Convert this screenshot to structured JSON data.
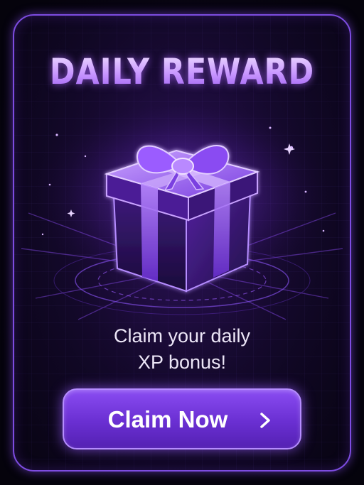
{
  "title": "DAILY REWARD",
  "subtitle": {
    "line1": "Claim your daily",
    "line2": "XP bonus!"
  },
  "claim_button": {
    "label": "Claim Now",
    "icon": "chevron-right-icon"
  },
  "colors": {
    "accent": "#8a4cf2",
    "border": "#7d4ce0",
    "glow": "#b58cff",
    "background": "#07040f",
    "text": "#ece6f7"
  }
}
